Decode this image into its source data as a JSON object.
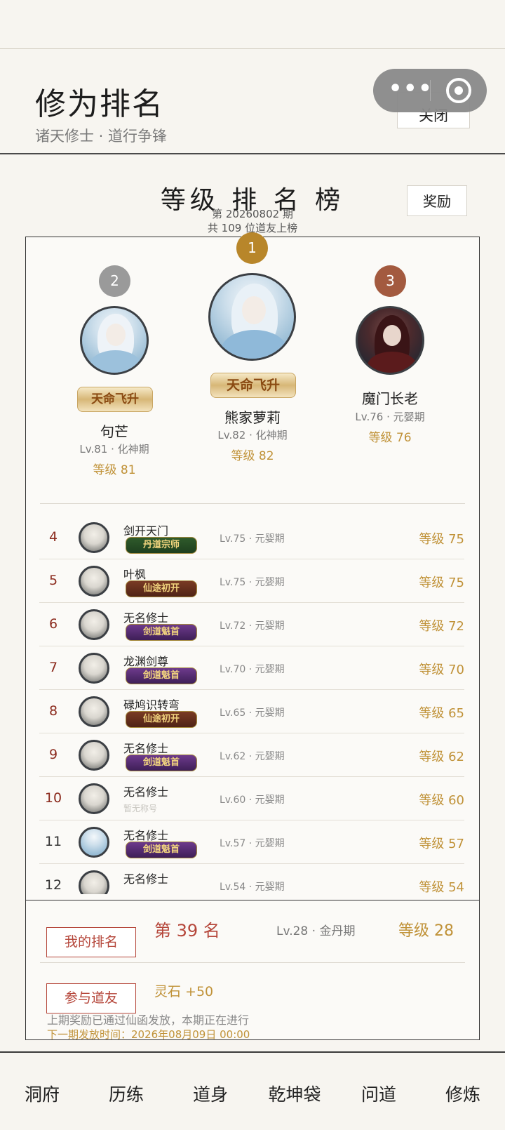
{
  "header": {
    "title": "修为排名",
    "subtitle": "诸天修士 · 道行争锋",
    "close_label": "关闭"
  },
  "board": {
    "title": "等级 排 名 榜",
    "period": "第 20260802 期",
    "total": "共 109 位道友上榜",
    "reward_label": "奖励"
  },
  "podium": [
    {
      "rank": "1",
      "name": "熊家萝莉",
      "level": "Lv.82 · 化神期",
      "grade": "等级 82",
      "title": "天命飞升"
    },
    {
      "rank": "2",
      "name": "句芒",
      "level": "Lv.81 · 化神期",
      "grade": "等级 81",
      "title": "天命飞升"
    },
    {
      "rank": "3",
      "name": "魔门长老",
      "level": "Lv.76 · 元婴期",
      "grade": "等级 76",
      "title": ""
    }
  ],
  "list": [
    {
      "rank": "4",
      "name": "剑开天门",
      "title": "丹道宗师",
      "level": "Lv.75 · 元婴期",
      "grade": "等级 75"
    },
    {
      "rank": "5",
      "name": "叶枫",
      "title": "仙途初开",
      "level": "Lv.75 · 元婴期",
      "grade": "等级 75"
    },
    {
      "rank": "6",
      "name": "无名修士",
      "title": "剑道魁首",
      "level": "Lv.72 · 元婴期",
      "grade": "等级 72"
    },
    {
      "rank": "7",
      "name": "龙渊剑尊",
      "title": "剑道魁首",
      "level": "Lv.70 · 元婴期",
      "grade": "等级 70"
    },
    {
      "rank": "8",
      "name": "碌鸠识转弯",
      "title": "仙途初开",
      "level": "Lv.65 · 元婴期",
      "grade": "等级 65"
    },
    {
      "rank": "9",
      "name": "无名修士",
      "title": "剑道魁首",
      "level": "Lv.62 · 元婴期",
      "grade": "等级 62"
    },
    {
      "rank": "10",
      "name": "无名修士",
      "title": "暂无称号",
      "level": "Lv.60 · 元婴期",
      "grade": "等级 60"
    },
    {
      "rank": "11",
      "name": "无名修士",
      "title": "剑道魁首",
      "level": "Lv.57 · 元婴期",
      "grade": "等级 57"
    },
    {
      "rank": "12",
      "name": "无名修士",
      "title": "",
      "level": "Lv.54 · 元婴期",
      "grade": "等级 54"
    }
  ],
  "my": {
    "my_rank_label": "我的排名",
    "rank_text": "第 39 名",
    "level": "Lv.28 · 金丹期",
    "grade": "等级 28",
    "join_label": "参与道友",
    "reward": "灵石 +50",
    "note": "上期奖励已通过仙函发放，本期正在进行",
    "next_time": "下一期发放时间：2026年08月09日 00:00"
  },
  "tabs": [
    "洞府",
    "历练",
    "道身",
    "乾坤袋",
    "问道",
    "修炼"
  ],
  "colors": {
    "gold": "#c09238",
    "red": "#b5463a",
    "rank1": "#b8862a",
    "rank2": "#9a9a9a",
    "rank3": "#a35a3f"
  }
}
